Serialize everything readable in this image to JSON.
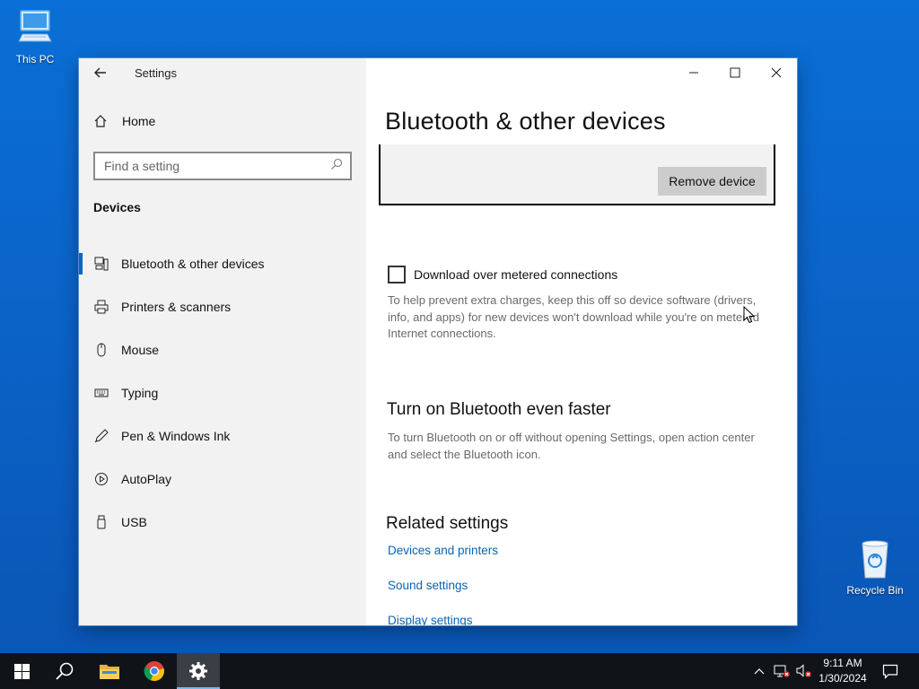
{
  "desktop": {
    "icons": [
      {
        "label": "This PC"
      },
      {
        "label": "Recycle Bin"
      }
    ]
  },
  "window": {
    "app_title": "Settings"
  },
  "sidebar": {
    "home_label": "Home",
    "search_placeholder": "Find a setting",
    "section_label": "Devices",
    "items": [
      {
        "label": "Bluetooth & other devices",
        "icon": "bluetooth-devices-icon",
        "active": true
      },
      {
        "label": "Printers & scanners",
        "icon": "printer-icon",
        "active": false
      },
      {
        "label": "Mouse",
        "icon": "mouse-icon",
        "active": false
      },
      {
        "label": "Typing",
        "icon": "keyboard-icon",
        "active": false
      },
      {
        "label": "Pen & Windows Ink",
        "icon": "pen-icon",
        "active": false
      },
      {
        "label": "AutoPlay",
        "icon": "autoplay-icon",
        "active": false
      },
      {
        "label": "USB",
        "icon": "usb-icon",
        "active": false
      }
    ]
  },
  "content": {
    "title": "Bluetooth & other devices",
    "remove_device_label": "Remove device",
    "metered_checkbox_label": "Download over metered connections",
    "metered_checked": false,
    "metered_description": "To help prevent extra charges, keep this off so device software (drivers, info, and apps) for new devices won't download while you're on metered Internet connections.",
    "bt_faster_heading": "Turn on Bluetooth even faster",
    "bt_faster_description": "To turn Bluetooth on or off without opening Settings, open action center and select the Bluetooth icon.",
    "related_heading": "Related settings",
    "related_links": [
      {
        "label": "Devices and printers"
      },
      {
        "label": "Sound settings"
      },
      {
        "label": "Display settings"
      }
    ]
  },
  "taskbar": {
    "time": "9:11 AM",
    "date": "1/30/2024",
    "active_app": "settings"
  },
  "colors": {
    "accent": "#0067c0",
    "link": "#0a64b6",
    "sidebar_bg": "#f2f2f2",
    "taskbar_bg": "#101419"
  }
}
